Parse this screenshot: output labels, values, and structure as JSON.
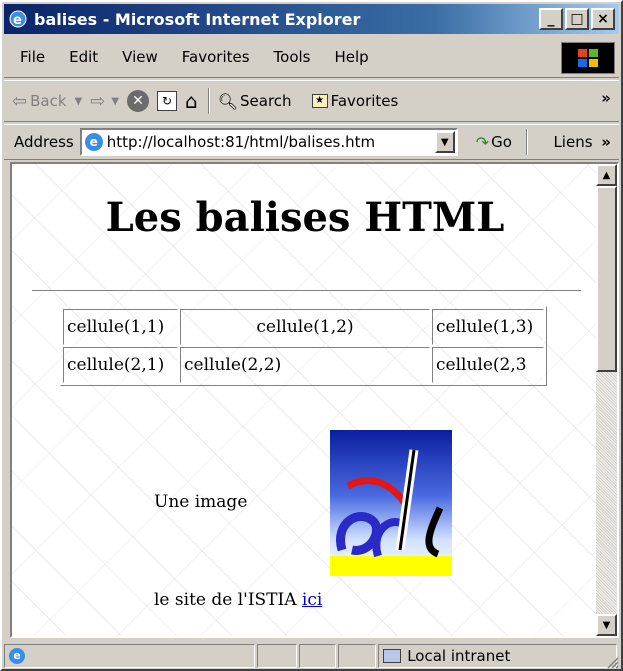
{
  "window": {
    "title": "balises - Microsoft Internet Explorer"
  },
  "title_buttons": {
    "minimize": "_",
    "maximize": "□",
    "close": "×"
  },
  "menu": [
    "File",
    "Edit",
    "View",
    "Favorites",
    "Tools",
    "Help"
  ],
  "toolbar": {
    "back": "Back",
    "search": "Search",
    "favorites": "Favorites",
    "more": "»"
  },
  "address": {
    "label": "Address",
    "url": "http://localhost:81/html/balises.htm",
    "go": "Go",
    "links": "Liens",
    "links_more": "»"
  },
  "page": {
    "heading": "Les balises HTML",
    "table": [
      [
        "cellule(1,1)",
        "cellule(1,2)",
        "cellule(1,3)"
      ],
      [
        "cellule(2,1)",
        "cellule(2,2)",
        "cellule(2,3"
      ]
    ],
    "image_label": "Une image",
    "site_text": "le site de l'ISTIA",
    "site_link": "ici"
  },
  "status": {
    "zone": "Local intranet"
  },
  "colors": {
    "title_start": "#0a246a",
    "title_end": "#a6caf0",
    "link": "#0000cc",
    "chrome": "#d4d0c8"
  }
}
